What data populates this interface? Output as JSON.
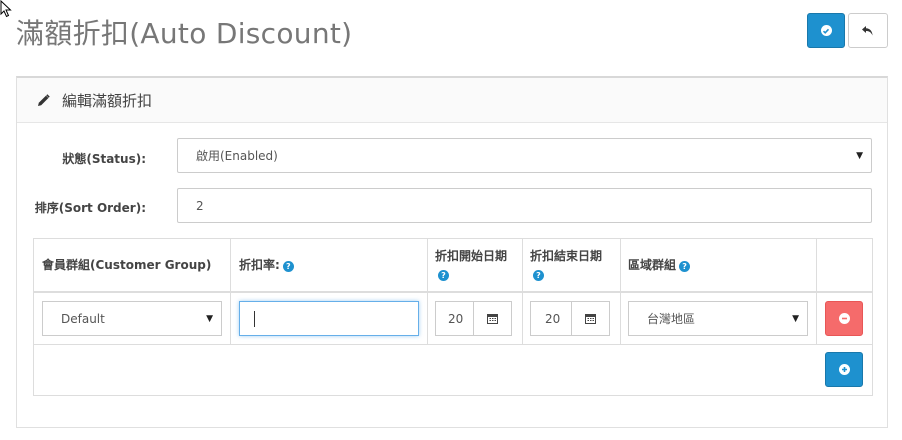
{
  "header": {
    "title": "滿額折扣(Auto Discount)",
    "save_icon": "check-circle-icon",
    "back_icon": "reply-icon"
  },
  "panel": {
    "heading": "編輯滿額折扣",
    "heading_icon": "pencil-icon"
  },
  "form": {
    "status_label": "狀態(Status):",
    "status_value": "啟用(Enabled)",
    "sort_label": "排序(Sort Order):",
    "sort_value": "2"
  },
  "table": {
    "headers": {
      "customer_group": "會員群組(Customer Group)",
      "discount_rate": "折扣率:",
      "start_date": "折扣開始日期",
      "end_date": "折扣結束日期",
      "region_group": "區域群組"
    },
    "row": {
      "customer_group": "Default",
      "discount_rate": "",
      "start_date": "20",
      "end_date": "20",
      "region_group": "台灣地區"
    },
    "help_glyph": "?",
    "calendar_icon": "calendar-icon",
    "remove_icon": "minus-circle-icon",
    "add_icon": "plus-circle-icon"
  },
  "colors": {
    "primary": "#1e91cf",
    "danger": "#f56b6b",
    "title": "#777777"
  }
}
